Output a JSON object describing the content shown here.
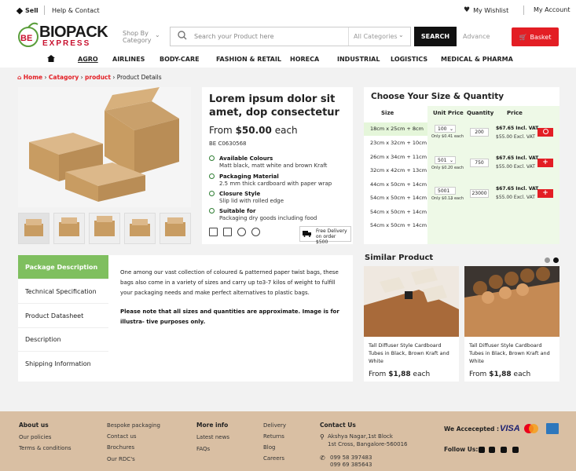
{
  "topbar": {
    "sell": "Sell",
    "help": "Help & Contact",
    "wishlist": "My Wishlist",
    "account": "My Account"
  },
  "logo": {
    "mark": "BE",
    "main": "BIOPACK",
    "sub": "EXPRESS"
  },
  "header": {
    "shop_by": [
      "Shop By",
      "Category"
    ],
    "search_placeholder": "Search your Product here",
    "category_select": "All Categories",
    "search_button": "SEARCH",
    "advance": "Advance",
    "basket": "Basket"
  },
  "nav": {
    "items": [
      "AGRO",
      "AIRLINES",
      "BODY-CARE",
      "FASHION & RETAIL",
      "HORECA",
      "INDUSTRIAL",
      "LOGISTICS",
      "MEDICAL & PHARMA"
    ]
  },
  "breadcrumb": {
    "home": "Home",
    "category": "Catagory",
    "product": "product",
    "current": "Product Details"
  },
  "product": {
    "title": "Lorem ipsum dolor sit amet, dop consectetur",
    "price_prefix": "From",
    "price": "$50.00",
    "price_suffix": "each",
    "code": "BE C0630568",
    "features": [
      {
        "title": "Available Colours",
        "desc": "Matt black, matt white and brown Kraft"
      },
      {
        "title": "Packaging Material",
        "desc": "2.5 mm thick cardboard with paper wrap"
      },
      {
        "title": "Closure Style",
        "desc": "Slip lid with rolled edge"
      },
      {
        "title": "Suitable for",
        "desc": "Packaging dry goods including food"
      }
    ],
    "delivery": [
      "Free Delivery",
      "on order $500"
    ]
  },
  "sizes": {
    "title": "Choose Your Size & Quantity",
    "headers": {
      "size": "Size",
      "unit_price": "Unit Price",
      "quantity": "Quantity",
      "price": "Price"
    },
    "list": [
      "18cm x 25cm + 8cm",
      "23cm x 32cm + 10cm",
      "26cm x 34cm + 11cm",
      "32cm x 42cm + 13cm",
      "44cm x 50cm + 14cm",
      "54cm x 50cm + 14cm",
      "54cm x 50cm + 14cm",
      "54cm x 50cm + 14cm"
    ],
    "rows": [
      {
        "unit": "100",
        "each": "Only $0.41 each",
        "qty": "200",
        "inc": "$67.65 Incl. VAT",
        "exc": "$55.00 Excl. VAT",
        "added": true
      },
      {
        "unit": "501",
        "each": "Only $0.20 each",
        "qty": "750",
        "inc": "$67.65 Incl. VAT",
        "exc": "$55.00 Excl. VAT",
        "added": false
      },
      {
        "unit": "5001",
        "each": "Only $0.13 each",
        "qty": "23000",
        "inc": "$67.65 Incl. VAT",
        "exc": "$55.00 Excl. VAT",
        "added": false
      }
    ]
  },
  "tabs": [
    "Package Description",
    "Technical Specification",
    "Product Datasheet",
    "Description",
    "Shipping Information"
  ],
  "description": {
    "text": "One among our vast collection of coloured & patterned paper twist bags, these bags also come in a variety of sizes and carry up to3-7 kilos of weight to fulfill your packaging needs and make perfect alternatives to plastic bags.",
    "note": "Please note that all sizes and quantities are approximate. Image is for illustra- tive purposes only."
  },
  "similar": {
    "title": "Similar Product",
    "items": [
      {
        "title": "Tall Diffuser Style Cardboard Tubes in Black, Brown Kraft and White",
        "price_prefix": "From",
        "price": "$1,88",
        "price_suffix": "each"
      },
      {
        "title": "Tall Diffuser Style Cardboard Tubes in Black, Brown Kraft and White",
        "price_prefix": "From",
        "price": "$1,88",
        "price_suffix": "each"
      }
    ]
  },
  "footer": {
    "about": {
      "title": "About us",
      "links": [
        "Our policies",
        "Terms & conditions"
      ]
    },
    "col2": [
      "Bespoke packaging",
      "Contact us",
      "Brochures",
      "Our RDC's"
    ],
    "more": {
      "title": "More info",
      "links": [
        "Latest news",
        "FAQs"
      ]
    },
    "col4": [
      "Delivery",
      "Returns",
      "Blog",
      "Careers"
    ],
    "contact": {
      "title": "Contact Us",
      "address": [
        "Akshya Nagar,1st Block",
        "1st Cross, Bangalore-560016"
      ],
      "phones": [
        "099 58 397483",
        "099 69 385643"
      ]
    },
    "accepted": "We Accecepted :",
    "follow": "Follow Us:"
  },
  "colors": {
    "accent": "#e31e24",
    "green": "#7fbf5f",
    "panel_green": "#eef9e7",
    "footer": "#d9bfa3"
  }
}
